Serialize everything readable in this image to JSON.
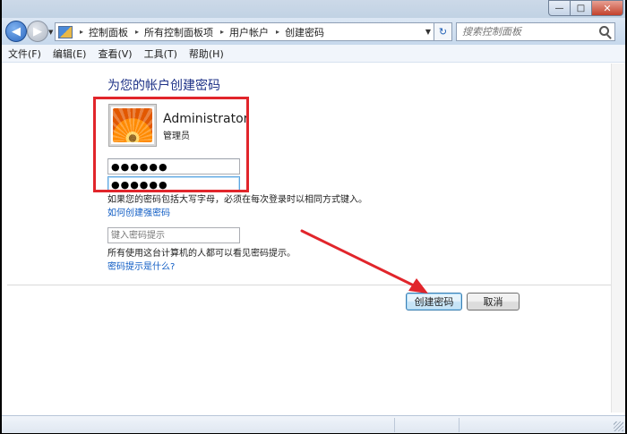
{
  "window": {
    "caption_min": "—",
    "caption_max": "□",
    "caption_close": "✕"
  },
  "nav": {
    "back_glyph": "◀",
    "forward_glyph": "▶",
    "dropdown_glyph": "▼",
    "breadcrumbs": [
      "控制面板",
      "所有控制面板项",
      "用户帐户",
      "创建密码"
    ],
    "separator_glyph": "▸",
    "refresh_glyph": "↻"
  },
  "search": {
    "placeholder": "搜索控制面板"
  },
  "menu": {
    "items": [
      "文件(F)",
      "编辑(E)",
      "查看(V)",
      "工具(T)",
      "帮助(H)"
    ]
  },
  "main": {
    "title": "为您的帐户创建密码",
    "user": {
      "name": "Administrator",
      "role": "管理员"
    },
    "password_value": "●●●●●●",
    "confirm_value": "●●●●●●",
    "note_case": "如果您的密码包括大写字母，必须在每次登录时以相同方式键入。",
    "link_strong_password": "如何创建强密码",
    "hint_placeholder": "键入密码提示",
    "note_hint_visible": "所有使用这台计算机的人都可以看见密码提示。",
    "link_what_is_hint": "密码提示是什么?"
  },
  "buttons": {
    "create": "创建密码",
    "cancel": "取消"
  },
  "colors": {
    "annotation_red": "#e1252b",
    "link_blue": "#0f5cc4",
    "title_blue": "#1e3287"
  }
}
